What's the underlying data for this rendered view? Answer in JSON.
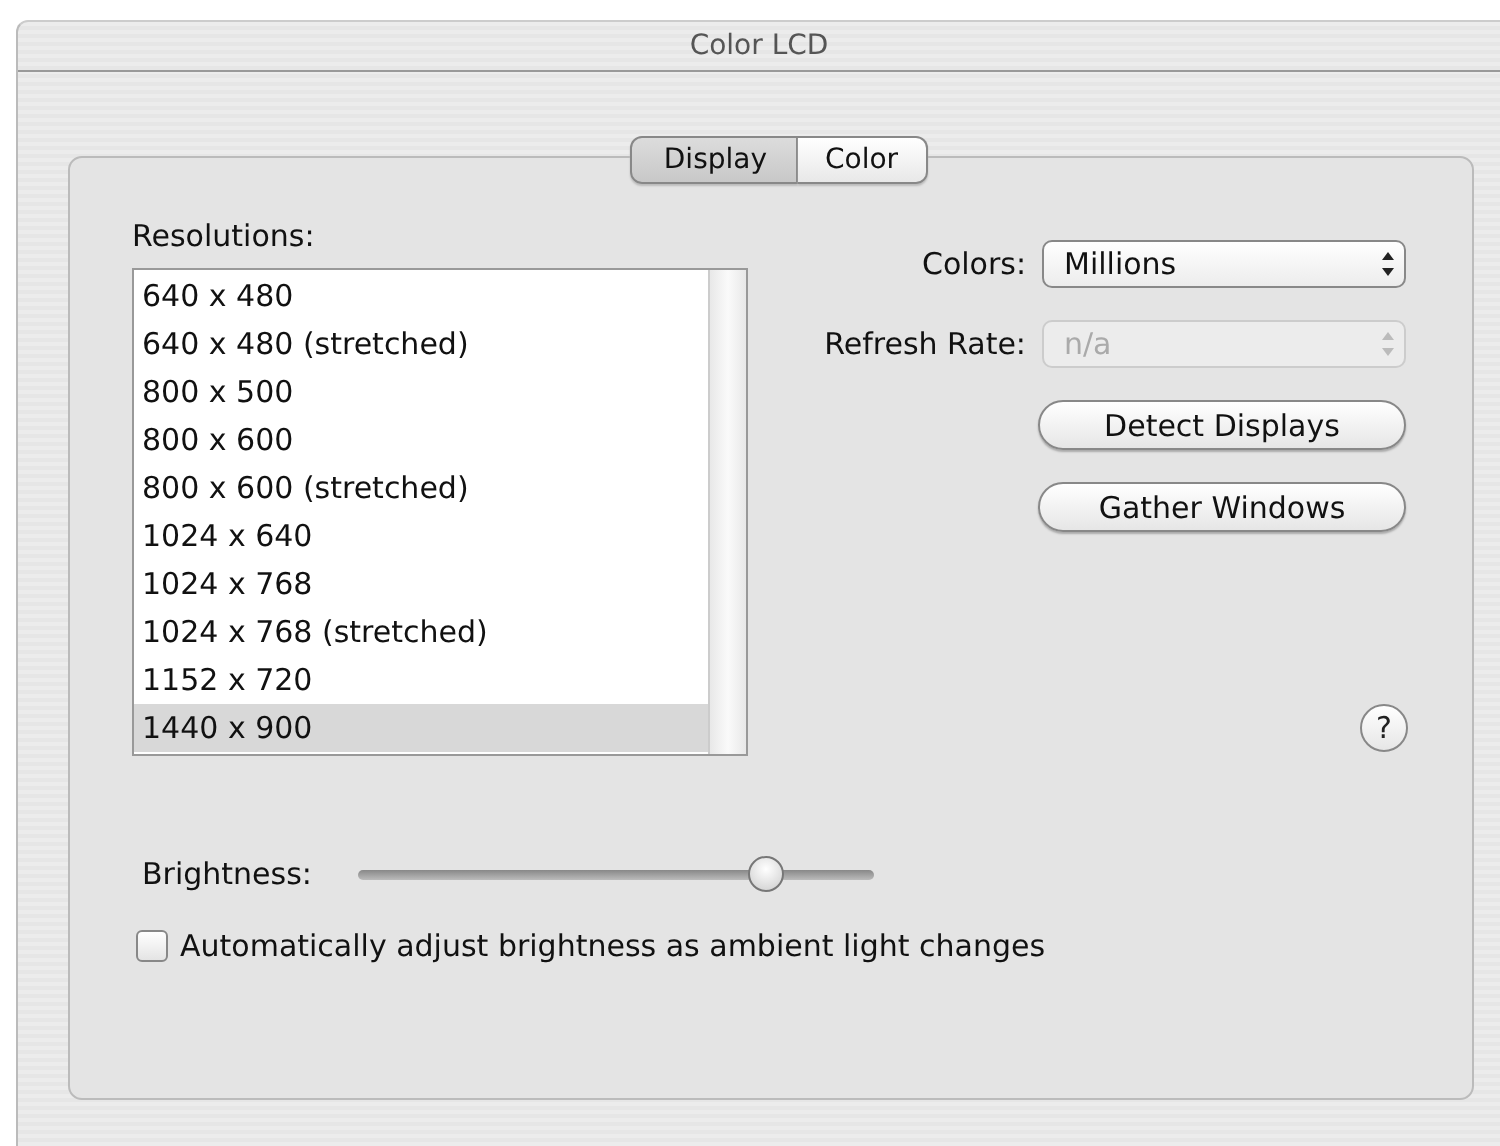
{
  "window": {
    "title": "Color LCD"
  },
  "tabs": [
    {
      "label": "Display",
      "selected": true
    },
    {
      "label": "Color",
      "selected": false
    }
  ],
  "resolutions": {
    "label": "Resolutions:",
    "items": [
      {
        "label": "640 x 480",
        "selected": false
      },
      {
        "label": "640 x 480 (stretched)",
        "selected": false
      },
      {
        "label": "800 x 500",
        "selected": false
      },
      {
        "label": "800 x 600",
        "selected": false
      },
      {
        "label": "800 x 600 (stretched)",
        "selected": false
      },
      {
        "label": "1024 x 640",
        "selected": false
      },
      {
        "label": "1024 x 768",
        "selected": false
      },
      {
        "label": "1024 x 768 (stretched)",
        "selected": false
      },
      {
        "label": "1152 x 720",
        "selected": false
      },
      {
        "label": "1440 x 900",
        "selected": true
      }
    ]
  },
  "popups": [
    {
      "label": "Colors:",
      "value": "Millions",
      "disabled": false
    },
    {
      "label": "Refresh Rate:",
      "value": "n/a",
      "disabled": true
    }
  ],
  "buttons": [
    "Detect Displays",
    "Gather Windows"
  ],
  "help": "?",
  "brightness": {
    "label": "Brightness:",
    "level": 0.79
  },
  "auto_brightness": {
    "label": "Automatically adjust brightness as ambient light changes",
    "checked": false
  }
}
